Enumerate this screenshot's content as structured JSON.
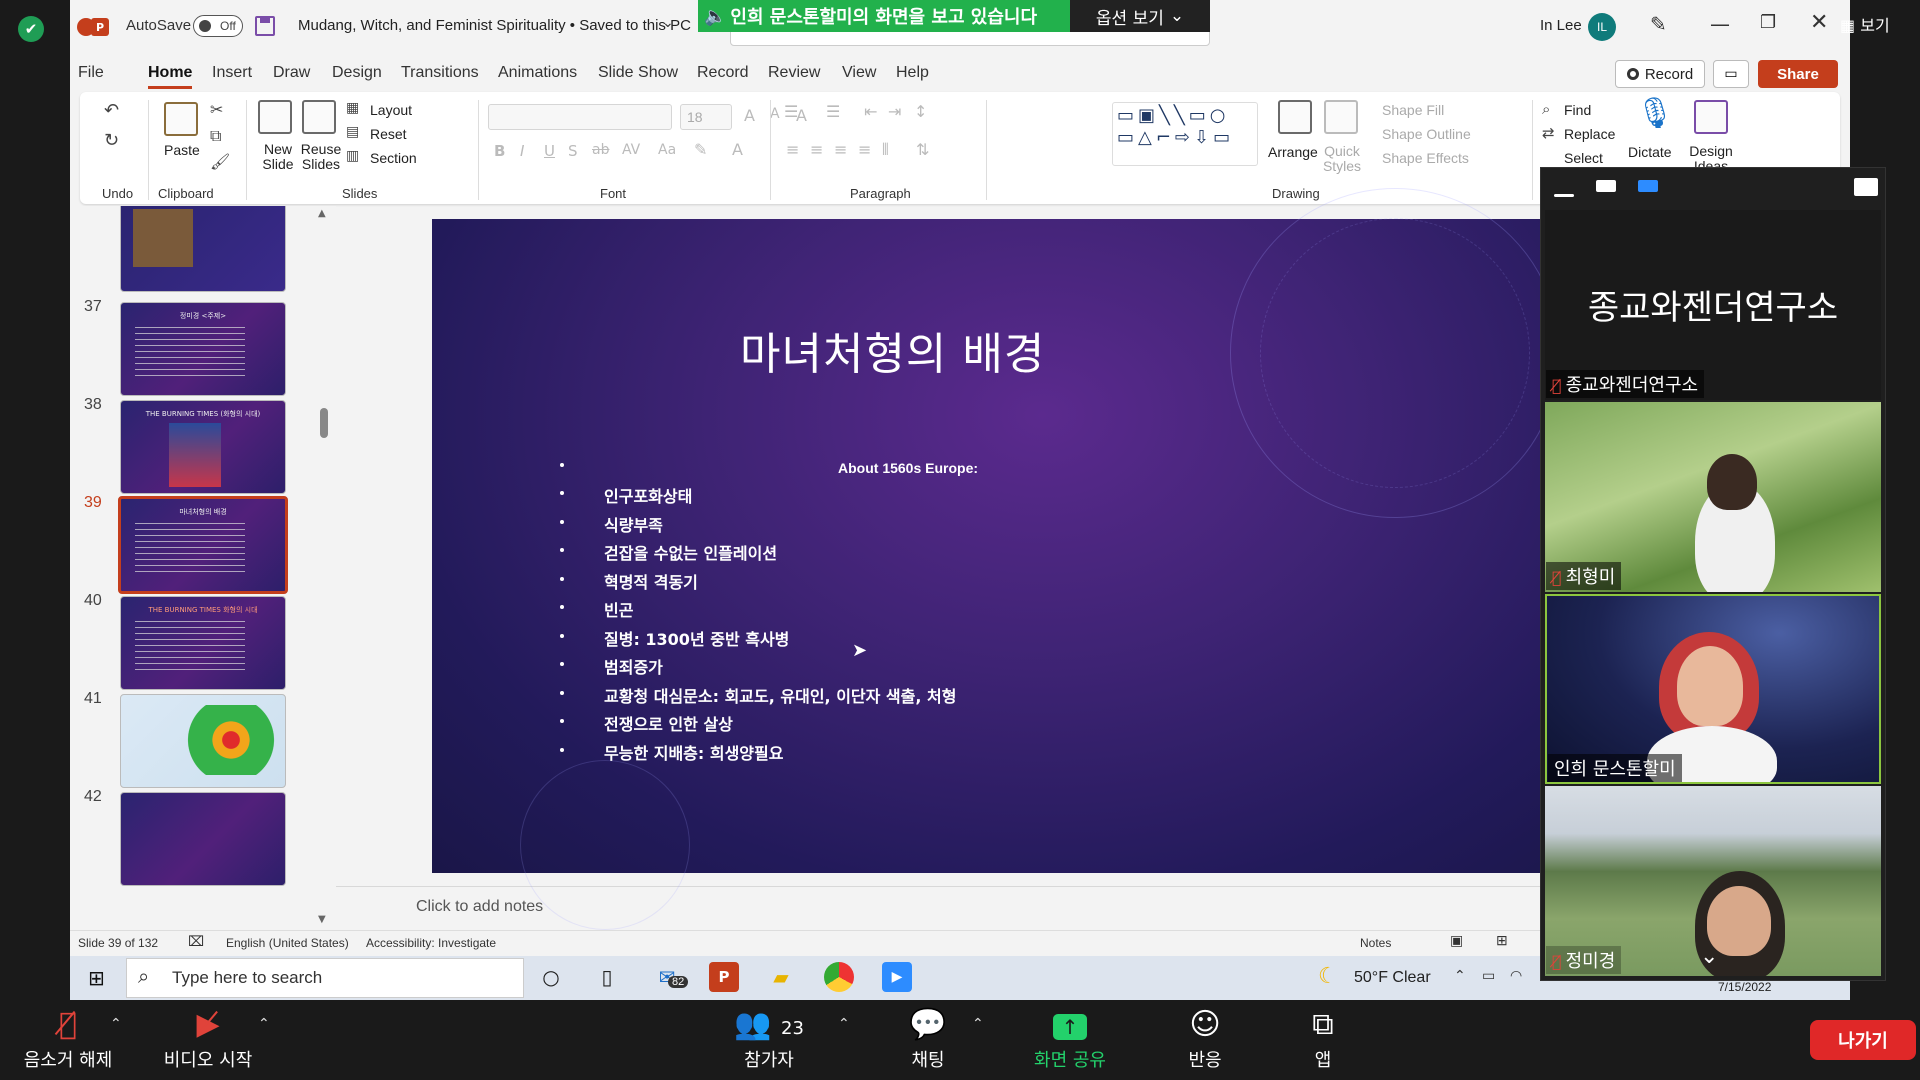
{
  "ppt": {
    "autosave_label": "AutoSave",
    "autosave_state": "Off",
    "doc_title": "Mudang, Witch, and Feminist Spirituality • Saved to this PC",
    "user_name": "In Lee",
    "user_initials": "IL",
    "tabs": [
      "File",
      "Home",
      "Insert",
      "Draw",
      "Design",
      "Transitions",
      "Animations",
      "Slide Show",
      "Record",
      "Review",
      "View",
      "Help"
    ],
    "record_label": "Record",
    "share_label": "Share",
    "groups": {
      "undo": "Undo",
      "clipboard": "Clipboard",
      "slides": "Slides",
      "font": "Font",
      "paragraph": "Paragraph",
      "drawing": "Drawing"
    },
    "buttons": {
      "paste": "Paste",
      "new_slide": "New Slide",
      "reuse_slides": "Reuse Slides",
      "layout": "Layout",
      "reset": "Reset",
      "section": "Section",
      "font_size": "18",
      "arrange": "Arrange",
      "quick_styles": "Quick Styles",
      "shape_fill": "Shape Fill",
      "shape_outline": "Shape Outline",
      "shape_effects": "Shape Effects",
      "find": "Find",
      "replace": "Replace",
      "select": "Select",
      "dictate": "Dictate",
      "design_ideas": "Design Ideas"
    },
    "thumbnails": [
      {
        "num": "37",
        "title": "정미경 <주제>"
      },
      {
        "num": "38",
        "title": "THE BURNING TIMES (화형의 시대)"
      },
      {
        "num": "39",
        "title": "마녀처형의 배경"
      },
      {
        "num": "40",
        "title": "THE BURNING TIMES 화형의 시대"
      },
      {
        "num": "41",
        "title": ""
      },
      {
        "num": "42",
        "title": ""
      }
    ],
    "slide": {
      "title": "마녀처형의 배경",
      "about": "About 1560s Europe:",
      "bullets": [
        "",
        "인구포화상태",
        "식량부족",
        "걷잡을 수없는 인플레이션",
        "혁명적 격동기",
        "빈곤",
        "질병: 1300년 중반 흑사병",
        "범죄증가",
        "교황청 대심문소: 회교도, 유대인, 이단자 색출, 처형",
        "전쟁으로 인한 살상",
        "무능한 지배층: 희생양필요"
      ]
    },
    "notes_placeholder": "Click to add notes",
    "status": {
      "slide_counter": "Slide 39 of 132",
      "language": "English (United States)",
      "accessibility": "Accessibility: Investigate",
      "notes": "Notes"
    }
  },
  "taskbar": {
    "search_placeholder": "Type here to search",
    "mail_badge": "82",
    "weather": "50°F  Clear",
    "date": "7/15/2022"
  },
  "zoom": {
    "share_banner": "인희 문스톤할미의 화면을 보고 있습니다",
    "view_options": "옵션 보기",
    "view_btn": "보기",
    "org_title": "종교와젠더연구소",
    "participants": [
      {
        "name": "종교와젠더연구소"
      },
      {
        "name": "최형미"
      },
      {
        "name": "인희 문스톤할미"
      },
      {
        "name": "정미경"
      }
    ],
    "toolbar": {
      "unmute": "음소거 해제",
      "start_video": "비디오 시작",
      "participants": "참가자",
      "participants_count": "23",
      "chat": "채팅",
      "share_screen": "화면 공유",
      "reactions": "반응",
      "apps": "앱",
      "leave": "나가기"
    }
  },
  "colors": {
    "ppt_accent": "#c43e1c",
    "zoom_green": "#22b14c",
    "leave_red": "#e02828"
  }
}
